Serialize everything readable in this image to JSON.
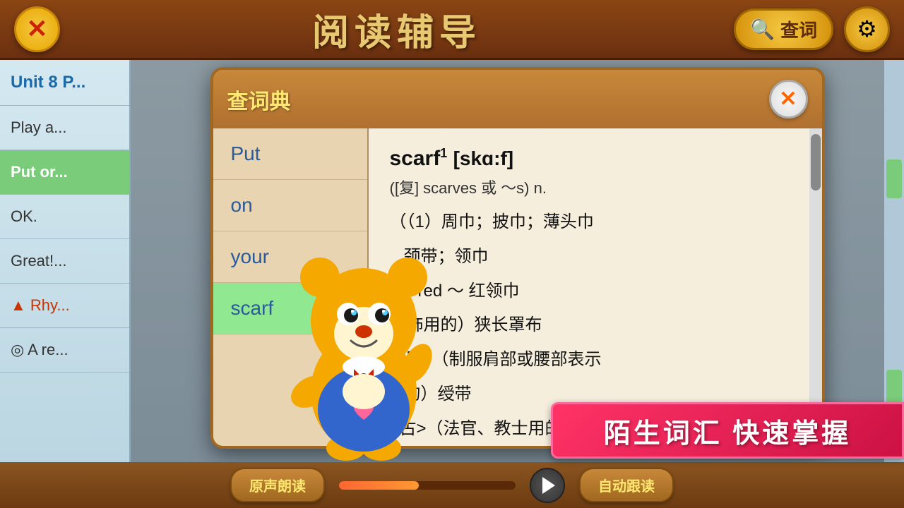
{
  "app": {
    "title": "阅读辅导",
    "close_label": "✕",
    "search_label": "查词",
    "gear_label": "⚙"
  },
  "sidebar": {
    "items": [
      {
        "id": "unit-header",
        "label": "Unit 8 P...",
        "type": "unit-header"
      },
      {
        "id": "play-a",
        "label": "Play a...",
        "type": "normal"
      },
      {
        "id": "put-or",
        "label": "Put or...",
        "type": "active"
      },
      {
        "id": "ok",
        "label": "OK.",
        "type": "normal"
      },
      {
        "id": "great",
        "label": "Great!...",
        "type": "normal"
      },
      {
        "id": "rhyme",
        "label": "▲ Rhy...",
        "type": "rhyme"
      },
      {
        "id": "a-re",
        "label": "◎ A re...",
        "type": "normal"
      }
    ]
  },
  "dictionary": {
    "title": "查词典",
    "close_label": "✕",
    "words": [
      {
        "id": "put",
        "label": "Put",
        "selected": false
      },
      {
        "id": "on",
        "label": "on",
        "selected": false
      },
      {
        "id": "your",
        "label": "your",
        "selected": false
      },
      {
        "id": "scarf",
        "label": "scarf",
        "selected": true
      }
    ],
    "definition": {
      "word": "scarf",
      "superscript": "1",
      "pronunciation": "[skɑ:f]",
      "plural": "([复] scarves 或 ～s) n.",
      "meanings": [
        "（（1）周巾；披巾；薄头巾",
        "颈带；领巾",
        "a red ～ 红领巾",
        "装饰用的）狭长罩布",
        "【军】（制服肩部或腰部表示",
        "的）绶带",
        "<古>（法官、教士用的）披肩"
      ]
    },
    "scrollbar": {
      "visible": true
    }
  },
  "audio": {
    "original_label": "原声朗读",
    "play_label": "▶",
    "auto_label": "自动跟读"
  },
  "promo": {
    "text": "陌生词汇 快速掌握"
  },
  "bear": {
    "name": "bear-mascot"
  }
}
